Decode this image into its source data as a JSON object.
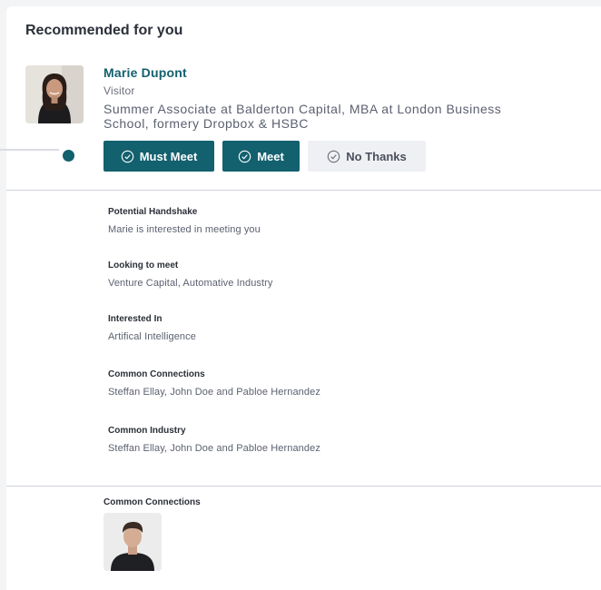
{
  "section": {
    "title": "Recommended for you"
  },
  "profile": {
    "name": "Marie Dupont",
    "role": "Visitor",
    "bio": "Summer Associate at Balderton Capital, MBA at London Business School, formery Dropbox & HSBC"
  },
  "actions": {
    "must_meet": "Must Meet",
    "meet": "Meet",
    "no_thanks": "No Thanks"
  },
  "details": [
    {
      "label": "Potential Handshake",
      "value": "Marie is interested in meeting you"
    },
    {
      "label": "Looking to meet",
      "value": "Venture Capital, Automative Industry"
    },
    {
      "label": "Interested In",
      "value": "Artifical Intelligence"
    },
    {
      "label": "Common Connections",
      "value": "Steffan Ellay, John Doe and Pabloe Hernandez"
    },
    {
      "label": "Common Industry",
      "value": "Steffan Ellay, John Doe and Pabloe Hernandez"
    }
  ],
  "connections": {
    "title": "Common Connections"
  },
  "colors": {
    "accent": "#13606e",
    "secondary_button": "#eef0f3",
    "divider": "#cfd3d8"
  },
  "icons": [
    "check-circle-icon",
    "avatar-photo",
    "timeline-dot"
  ]
}
